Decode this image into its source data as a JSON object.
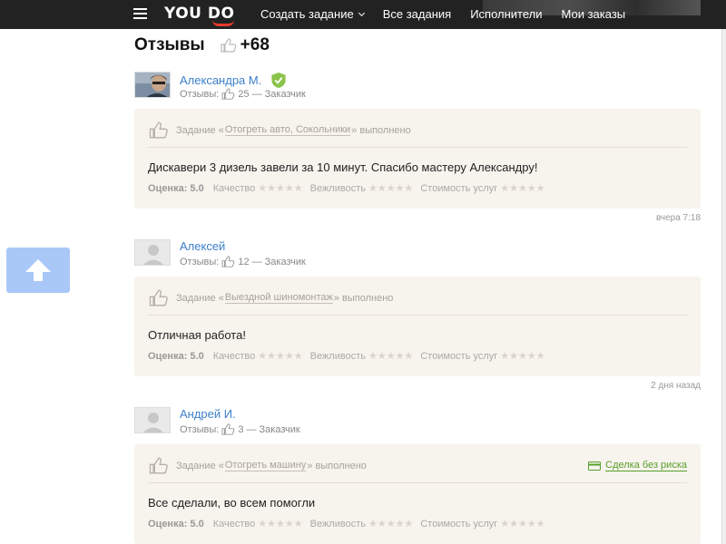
{
  "header": {
    "logo_text": "YOU DO",
    "nav": [
      {
        "label": "Создать задание",
        "has_dropdown": true
      },
      {
        "label": "Все задания"
      },
      {
        "label": "Исполнители"
      },
      {
        "label": "Мои заказы"
      }
    ]
  },
  "page": {
    "title": "Отзывы",
    "total_rating": "+68"
  },
  "rating_labels": {
    "score": "Оценка: 5.0",
    "quality": "Качество",
    "politeness": "Вежливость",
    "price": "Стоимость услуг"
  },
  "reviews": [
    {
      "name": "Александра М.",
      "verified": true,
      "likes": "25",
      "role": "— Заказчик",
      "task_prefix": "Задание «",
      "task_link": "Отогреть авто, Сокольники",
      "task_suffix": "» выполнено",
      "text": "Дискавери 3 дизель завели за 10 минут. Спасибо мастеру Александру!",
      "time": "вчера 7:18"
    },
    {
      "name": "Алексей",
      "verified": false,
      "likes": "12",
      "role": "— Заказчик",
      "task_prefix": "Задание «",
      "task_link": "Выездной шиномонтаж",
      "task_suffix": "» выполнено",
      "text": "Отличная работа!",
      "time": "2 дня назад"
    },
    {
      "name": "Андрей И.",
      "verified": false,
      "likes": "3",
      "role": "— Заказчик",
      "task_prefix": "Задание «",
      "task_link": "Отогреть машину",
      "task_suffix": "» выполнено",
      "deal": "Сделка без риска",
      "text": "Все сделали, во всем помогли",
      "time": ""
    }
  ],
  "colors": {
    "header_bg": "#222222",
    "link": "#3d7fc9",
    "card_bg": "#f7f3ed",
    "accent_red": "#ea3b2d",
    "verified_green": "#8bc34a",
    "deal_green": "#58a02b",
    "scroll_button": "#a9c8f8"
  },
  "icons": [
    "menu-icon",
    "thumbs-up-icon",
    "shield-check-icon",
    "card-icon",
    "star-icon",
    "arrow-up-icon"
  ]
}
